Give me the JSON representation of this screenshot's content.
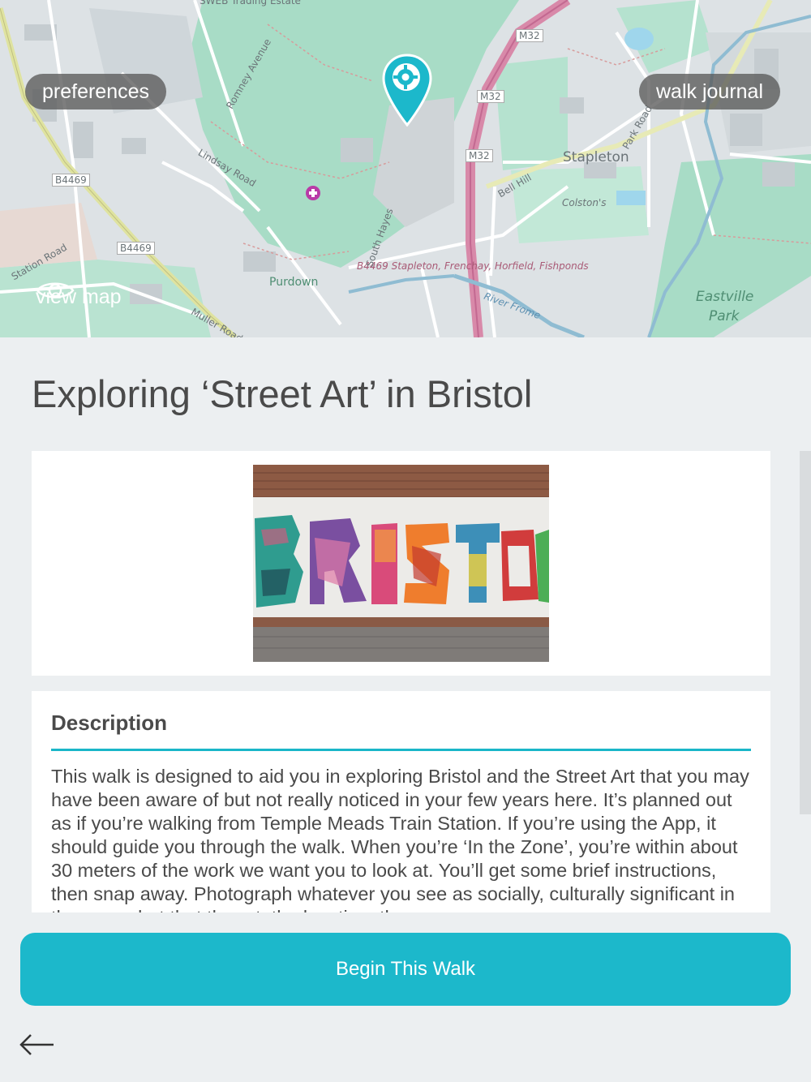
{
  "map": {
    "preferences_label": "preferences",
    "walk_journal_label": "walk journal",
    "view_map_label": "view map",
    "labels": {
      "estate": "SWEB Trading Estate",
      "m32_a": "M32",
      "m32_b": "M32",
      "m32_c": "M32",
      "b4469_a": "B4469",
      "b4469_b": "B4469",
      "stapleton": "Stapleton",
      "colstons": "Colston's",
      "purdown": "Purdown",
      "eastville": "Eastville",
      "park": "Park",
      "road_caption": "B4469 Stapleton, Frenchay, Horfield, Fishponds",
      "river_frome": "River Frome",
      "bell_hill": "Bell Hill",
      "park_road": "Park Road",
      "lindsay_road": "Lindsay Road",
      "romney_avenue": "Romney Avenue",
      "south_hayes": "South Hayes",
      "station_road": "Station Road",
      "muller_road": "Muller Road"
    }
  },
  "walk": {
    "title": "Exploring ‘Street Art’ in Bristol",
    "image_alt": "BRISTOL",
    "description_heading": "Description",
    "description_text": "This walk is designed to aid you in exploring Bristol and the Street Art that you may have been aware of but not really noticed in your few years here. It’s planned out as if you’re walking from Temple Meads Train Station.  If you’re using the App, it should guide you through the walk. When you’re ‘In the Zone’, you’re within about 30 meters of the work we want you to look at. You’ll get some brief instructions, then snap away. Photograph whatever you see as socially, culturally significant in the area - but that the art, the location, the"
  },
  "actions": {
    "begin_label": "Begin This Walk",
    "back_icon": "arrow-left-icon"
  },
  "colors": {
    "accent": "#1cb8cb",
    "background": "#eceff1"
  }
}
